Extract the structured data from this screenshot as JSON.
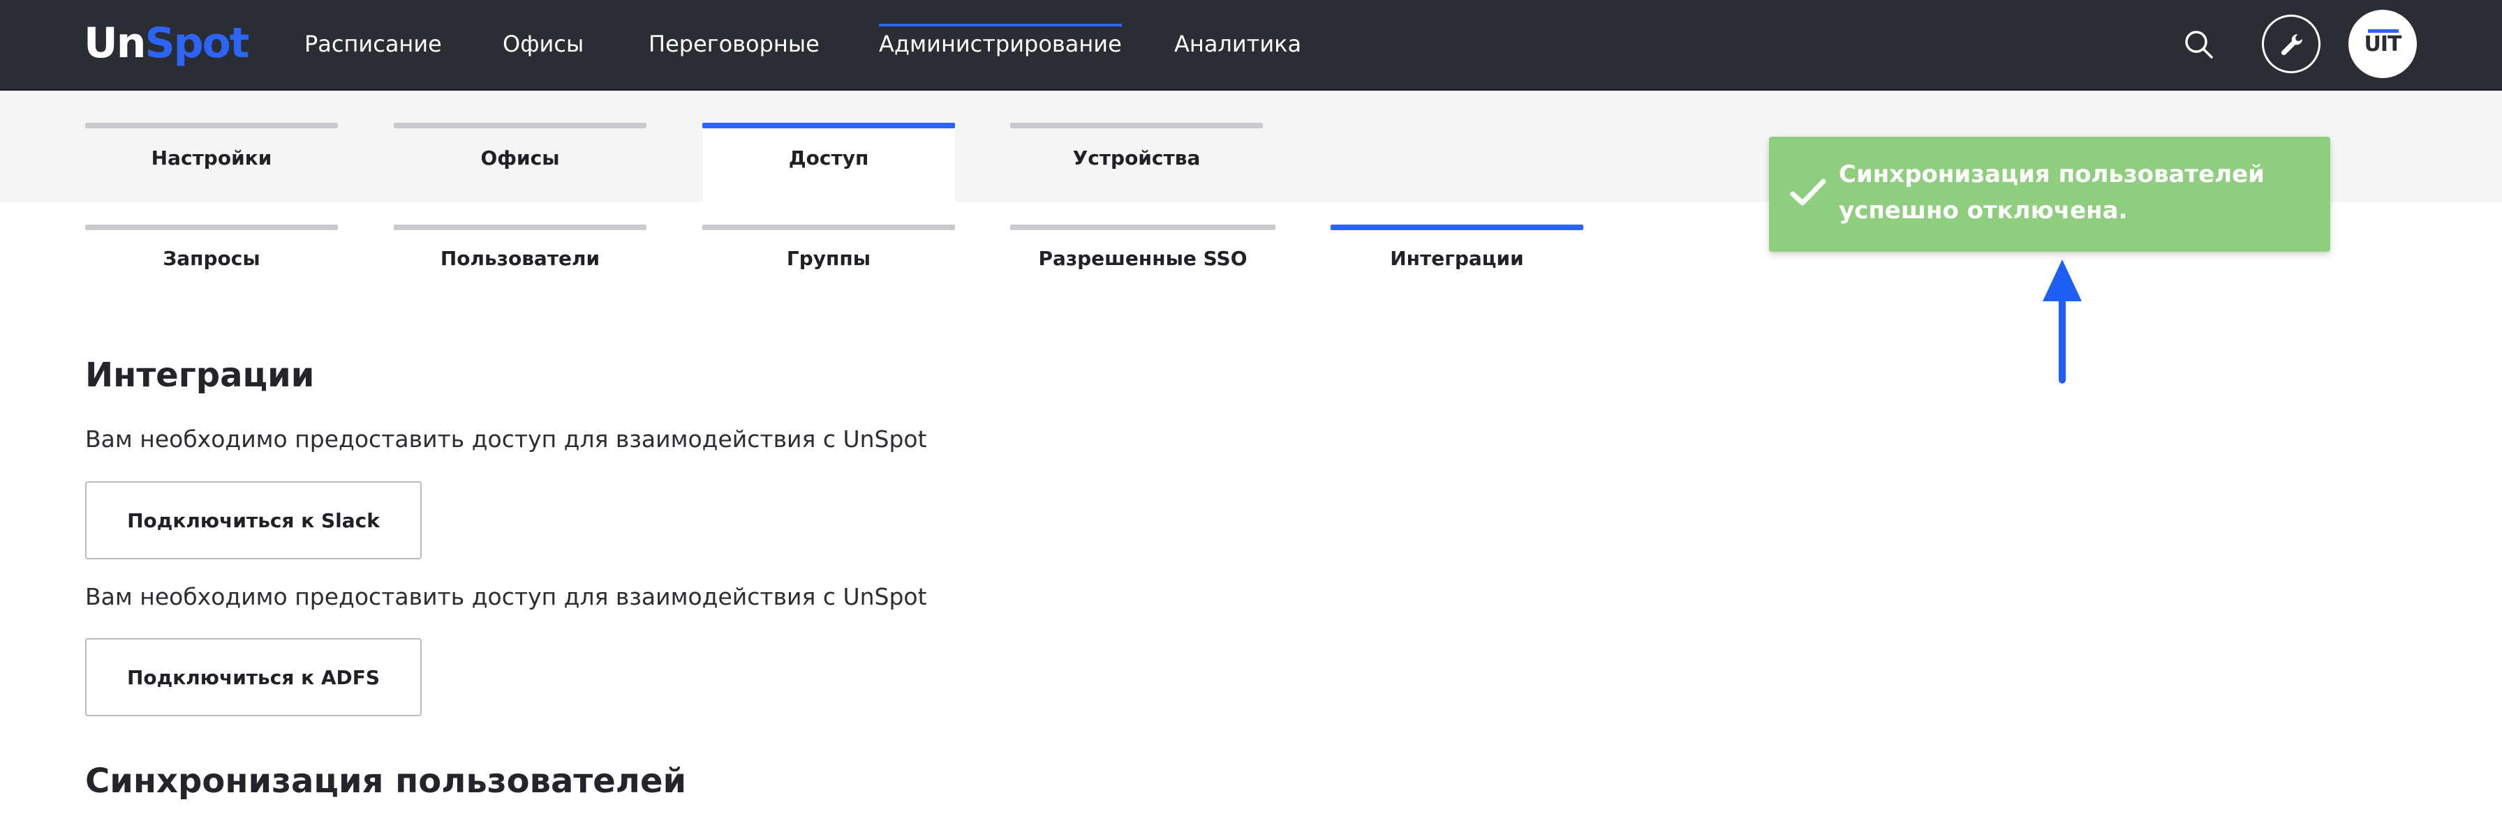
{
  "brand": {
    "logo_part1": "Un",
    "logo_part2": "Spot",
    "accent_color": "#2c64f5",
    "toast_color": "#8fce7f",
    "navbar_color": "#2a2d33"
  },
  "nav": {
    "items": [
      {
        "label": "Расписание"
      },
      {
        "label": "Офисы"
      },
      {
        "label": "Переговорные"
      },
      {
        "label": "Администрирование",
        "active": true
      },
      {
        "label": "Аналитика"
      }
    ],
    "search_icon": "search-icon",
    "tools_icon": "wrench-icon",
    "avatar_text": "UIT"
  },
  "tabs_primary": [
    {
      "label": "Настройки"
    },
    {
      "label": "Офисы"
    },
    {
      "label": "Доступ",
      "active": true
    },
    {
      "label": "Устройства"
    }
  ],
  "tabs_secondary": [
    {
      "label": "Запросы"
    },
    {
      "label": "Пользователи"
    },
    {
      "label": "Группы"
    },
    {
      "label": "Разрешенные SSO"
    },
    {
      "label": "Интеграции",
      "active": true
    }
  ],
  "content": {
    "integrations_title": "Интеграции",
    "slack": {
      "info": "Вам необходимо предоставить доступ для взаимодействия с UnSpot",
      "button_label": "Подключиться к Slack"
    },
    "adfs": {
      "info": "Вам необходимо предоставить доступ для взаимодействия с UnSpot",
      "button_label": "Подключиться к ADFS"
    },
    "sync_title": "Синхронизация пользователей"
  },
  "toast": {
    "icon": "check-icon",
    "message": "Синхронизация пользователей успешно отключена."
  },
  "annotation": {
    "icon": "arrow-up-icon"
  }
}
